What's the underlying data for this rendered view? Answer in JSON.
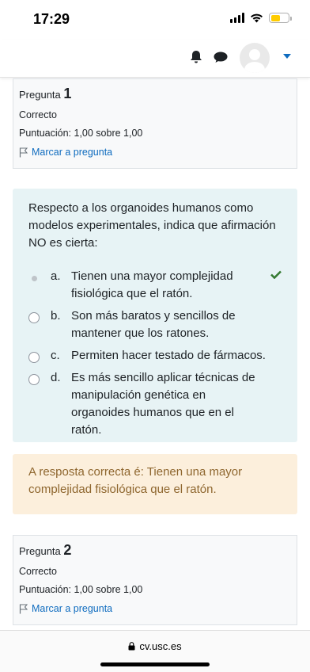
{
  "status": {
    "time": "17:29"
  },
  "question1": {
    "label": "Pregunta",
    "number": "1",
    "state": "Correcto",
    "grade": "Puntuación: 1,00 sobre 1,00",
    "flag_label": "Marcar a pregunta"
  },
  "formulation": {
    "text": "Respecto a los organoides humanos como modelos experimentales, indica que afirmación NO es cierta:",
    "answers": [
      {
        "letter": "a.",
        "text": "Tienen una mayor complejidad fisiológica que el ratón.",
        "selected": true,
        "correct": true
      },
      {
        "letter": "b.",
        "text": "Son más baratos y sencillos de mantener que los ratones.",
        "selected": false
      },
      {
        "letter": "c.",
        "text": "Permiten hacer testado de fármacos.",
        "selected": false
      },
      {
        "letter": "d.",
        "text": "Es más sencillo aplicar técnicas de manipulación genética en organoides humanos que en el ratón.",
        "selected": false
      }
    ]
  },
  "feedback": {
    "text": "A resposta correcta é: Tienen una mayor complejidad fisiológica que el ratón."
  },
  "question2": {
    "label": "Pregunta",
    "number": "2",
    "state": "Correcto",
    "grade": "Puntuación: 1,00 sobre 1,00",
    "flag_label": "Marcar a pregunta"
  },
  "browser": {
    "url": "cv.usc.es"
  },
  "colors": {
    "link": "#0f6cbf",
    "correct": "#357a32",
    "feedback_bg": "#fcefdc",
    "formulation_bg": "#e7f3f5"
  },
  "icons": [
    "bell-icon",
    "chat-icon",
    "avatar",
    "caret-down-icon",
    "flag-icon",
    "check-icon",
    "lock-icon"
  ]
}
